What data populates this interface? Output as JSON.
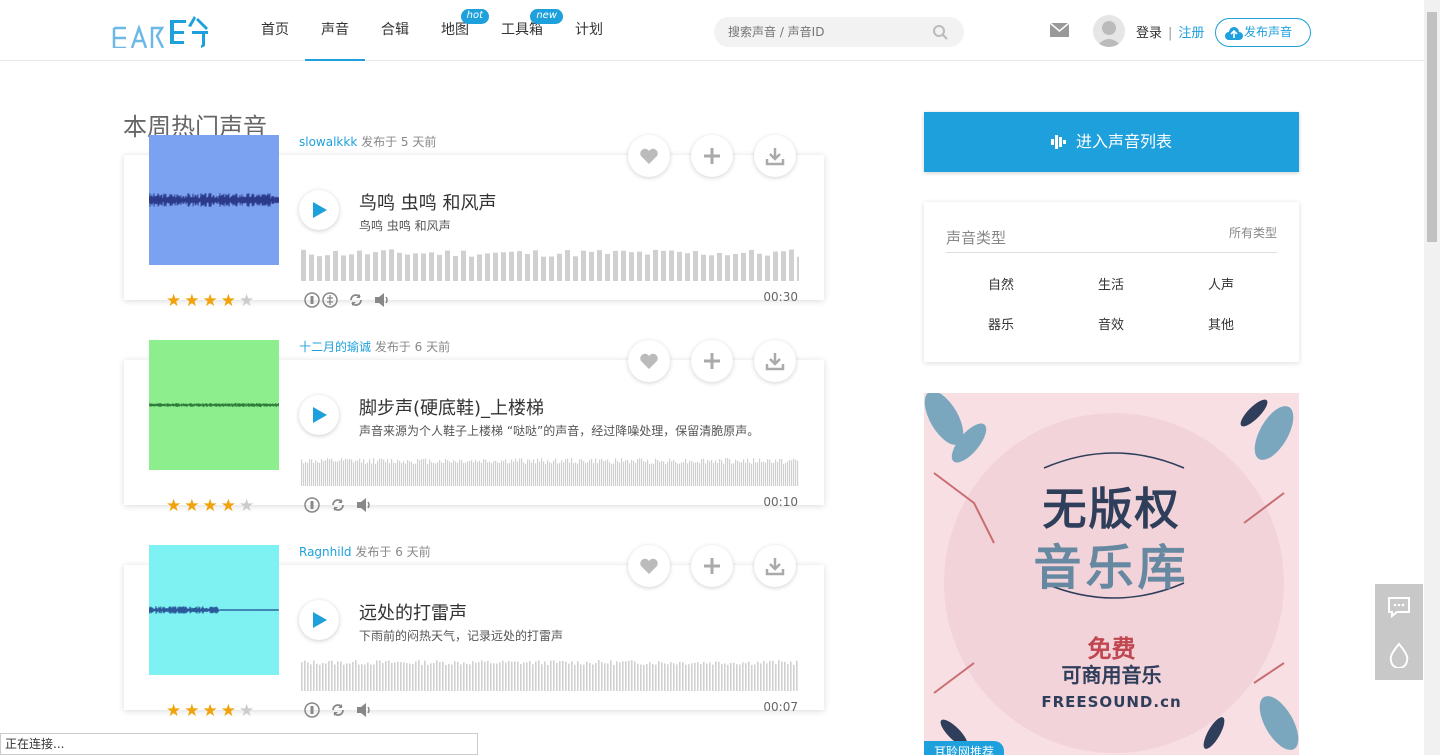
{
  "header": {
    "logo_text": "EAR 聆",
    "nav": [
      {
        "label": "首页",
        "badge": ""
      },
      {
        "label": "声音",
        "badge": ""
      },
      {
        "label": "合辑",
        "badge": ""
      },
      {
        "label": "地图",
        "badge": "hot"
      },
      {
        "label": "工具箱",
        "badge": "new"
      },
      {
        "label": "计划",
        "badge": ""
      }
    ],
    "search_placeholder": "搜索声音 / 声音ID",
    "login": "登录",
    "separator": "|",
    "register": "注册",
    "publish": "发布声音"
  },
  "main": {
    "section_title": "本周热门声音",
    "sounds": [
      {
        "author": "slowalkkk",
        "posted": "发布于 5 天前",
        "title": "鸟鸣 虫鸣 和风声",
        "description": "鸟鸣 虫鸣 和风声",
        "duration": "00:30",
        "rating": 4,
        "thumb_color": "#7ba2f0"
      },
      {
        "author": "十二月的瑜诚",
        "posted": "发布于 6 天前",
        "title": "脚步声(硬底鞋)_上楼梯",
        "description": "声音来源为个人鞋子上楼梯 “哒哒”的声音，经过降噪处理，保留清脆原声。",
        "duration": "00:10",
        "rating": 4,
        "thumb_color": "#8cee8c"
      },
      {
        "author": "Ragnhild",
        "posted": "发布于 6 天前",
        "title": "远处的打雷声",
        "description": "下雨前的闷热天气，记录远处的打雷声",
        "duration": "00:07",
        "rating": 4,
        "thumb_color": "#7ef2f2"
      }
    ]
  },
  "sidebar": {
    "enter_list": "进入声音列表",
    "types_title": "声音类型",
    "types_all": "所有类型",
    "types": [
      "自然",
      "生活",
      "人声",
      "器乐",
      "音效",
      "其他"
    ],
    "ad": {
      "line1": "无版权",
      "line2": "音乐库",
      "line3": "免费",
      "line4": "可商用音乐",
      "line5": "FREESOUND.cn",
      "tag": "耳聆网推荐"
    }
  },
  "status_bar": "正在连接...",
  "colors": {
    "accent": "#1ea0dc",
    "star": "#f0a30a"
  }
}
